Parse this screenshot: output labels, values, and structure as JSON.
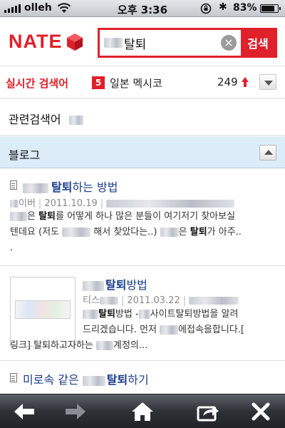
{
  "status_bar": {
    "carrier": "olleh",
    "time": "오후 3:36",
    "battery": "83%",
    "battery_level": 0.83
  },
  "header": {
    "logo": "NATE",
    "search_value": "탈퇴",
    "search_button": "검색"
  },
  "realtime": {
    "label": "실시간 검색어",
    "rank": "5",
    "term": "일본 멕시코",
    "count": "249"
  },
  "related": {
    "title": "관련검색어"
  },
  "blog": {
    "title": "블로그"
  },
  "results": [
    {
      "title_highlight": "탈퇴",
      "title_rest": "하는 방법",
      "meta_source": "이버",
      "meta_date": "2011.10.19",
      "desc_1a": "은 ",
      "desc_1b": "탈퇴",
      "desc_1c": "를 어떻게 하나 많은 분들이 여기저기 찾아보실",
      "desc_2a": "텐데요 (저도 ",
      "desc_2b": " 해서 찾았다는..) ",
      "desc_2c": "은 ",
      "desc_2d": "탈퇴",
      "desc_2e": "가 아주..",
      "desc_3": "."
    },
    {
      "title_highlight": "탈퇴",
      "title_rest": "방법",
      "meta_source": "티스",
      "meta_date": "2011.03.22",
      "desc_1a": "탈퇴",
      "desc_1b": "방법 -",
      "desc_1c": "사이트탈퇴방법을 알려",
      "desc_2": "드리겠습니다. 먼저 ",
      "desc_2b": "에접속을합니다.[",
      "desc_3a": "링크] 탈퇴하고자하는 ",
      "desc_3b": "계정의..."
    },
    {
      "title_pre": "미로속 같은 ",
      "title_highlight": "탈퇴",
      "title_rest": "하기"
    }
  ],
  "icons": {
    "back": "arrow-left-icon",
    "forward": "arrow-right-icon",
    "home": "home-icon",
    "share": "share-icon",
    "close": "close-icon"
  },
  "colors": {
    "brand": "#e0202a",
    "link": "#1a3d8a",
    "section_bg": "#dcecf8"
  }
}
